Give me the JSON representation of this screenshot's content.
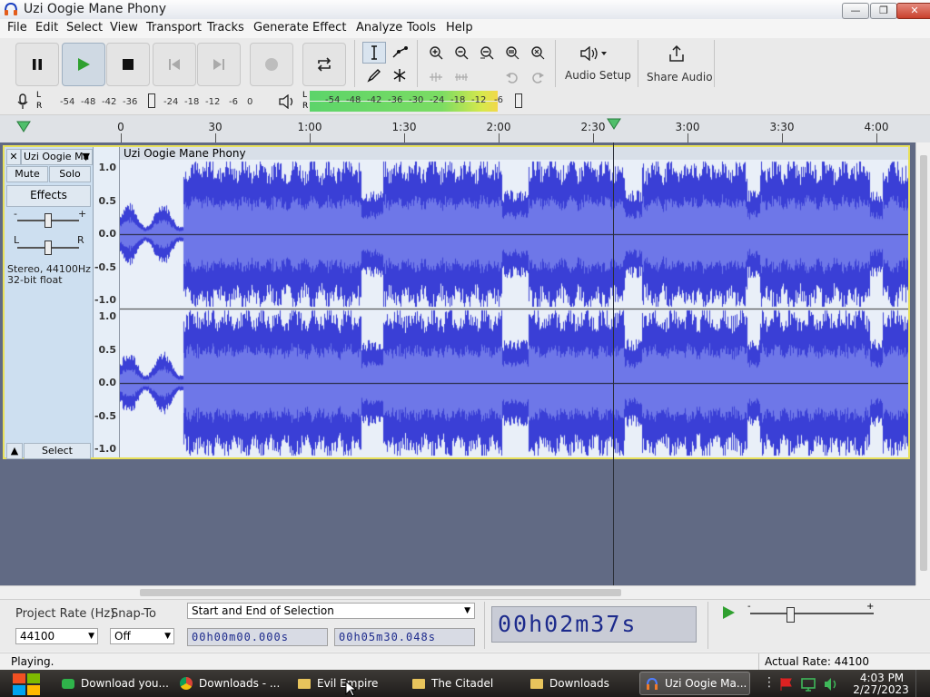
{
  "window": {
    "title": "Uzi Oogie Mane Phony",
    "minimize": "—",
    "maximize": "❐",
    "close": "✕"
  },
  "menu": [
    "File",
    "Edit",
    "Select",
    "View",
    "Transport",
    "Tracks",
    "Generate",
    "Effect",
    "Analyze",
    "Tools",
    "Help"
  ],
  "toolbar": {
    "audio_setup": "Audio Setup",
    "share_audio": "Share Audio"
  },
  "meters": {
    "record_ticks": [
      "-54",
      "-48",
      "-42",
      "-36",
      "-24",
      "-18",
      "-12",
      "-6",
      "0"
    ],
    "play_ticks": [
      "-54",
      "-48",
      "-42",
      "-36",
      "-30",
      "-24",
      "-18",
      "-12",
      "-6"
    ],
    "channel_l": "L",
    "channel_r": "R"
  },
  "timeline": {
    "labels": [
      {
        "t": "0",
        "x": 133
      },
      {
        "t": "30",
        "x": 237
      },
      {
        "t": "1:00",
        "x": 341
      },
      {
        "t": "1:30",
        "x": 445
      },
      {
        "t": "2:00",
        "x": 549
      },
      {
        "t": "2:30",
        "x": 653
      },
      {
        "t": "3:00",
        "x": 757
      },
      {
        "t": "3:30",
        "x": 861
      },
      {
        "t": "4:00",
        "x": 965
      }
    ]
  },
  "track": {
    "name": "Uzi Oogie Ma",
    "clip_name": "Uzi Oogie Mane Phony",
    "mute": "Mute",
    "solo": "Solo",
    "effects": "Effects",
    "gain_minus": "-",
    "gain_plus": "+",
    "pan_l": "L",
    "pan_r": "R",
    "info1": "Stereo, 44100Hz",
    "info2": "32-bit float",
    "select": "Select",
    "close": "✕",
    "collapse": "▲",
    "y_ticks": [
      "1.0",
      "0.5",
      "0.0",
      "-0.5",
      "-1.0"
    ]
  },
  "selection_bar": {
    "project_rate_label": "Project Rate (Hz)",
    "project_rate_value": "44100",
    "snap_to_label": "Snap-To",
    "snap_to_value": "Off",
    "selection_mode": "Start and End of Selection",
    "start_time": "00h00m00.000s",
    "end_time": "00h05m30.048s",
    "big_time": "00h02m37s"
  },
  "status": {
    "left": "Playing.",
    "right": "Actual Rate: 44100"
  },
  "taskbar": {
    "items": [
      {
        "label": "Download you...",
        "icon": "green"
      },
      {
        "label": "Downloads - ...",
        "icon": "chrome"
      },
      {
        "label": "Evil Empire",
        "icon": "folder"
      },
      {
        "label": "The Citadel",
        "icon": "folder"
      },
      {
        "label": "Downloads",
        "icon": "folder"
      },
      {
        "label": "Uzi Oogie Ma...",
        "icon": "audacity"
      }
    ],
    "clock_time": "4:03 PM",
    "clock_date": "2/27/2023"
  },
  "colors": {
    "wave": "#3a3fd6",
    "wave_rms": "#6e77e8",
    "track_border": "#e8e05a",
    "play_green": "#2fa02f"
  }
}
